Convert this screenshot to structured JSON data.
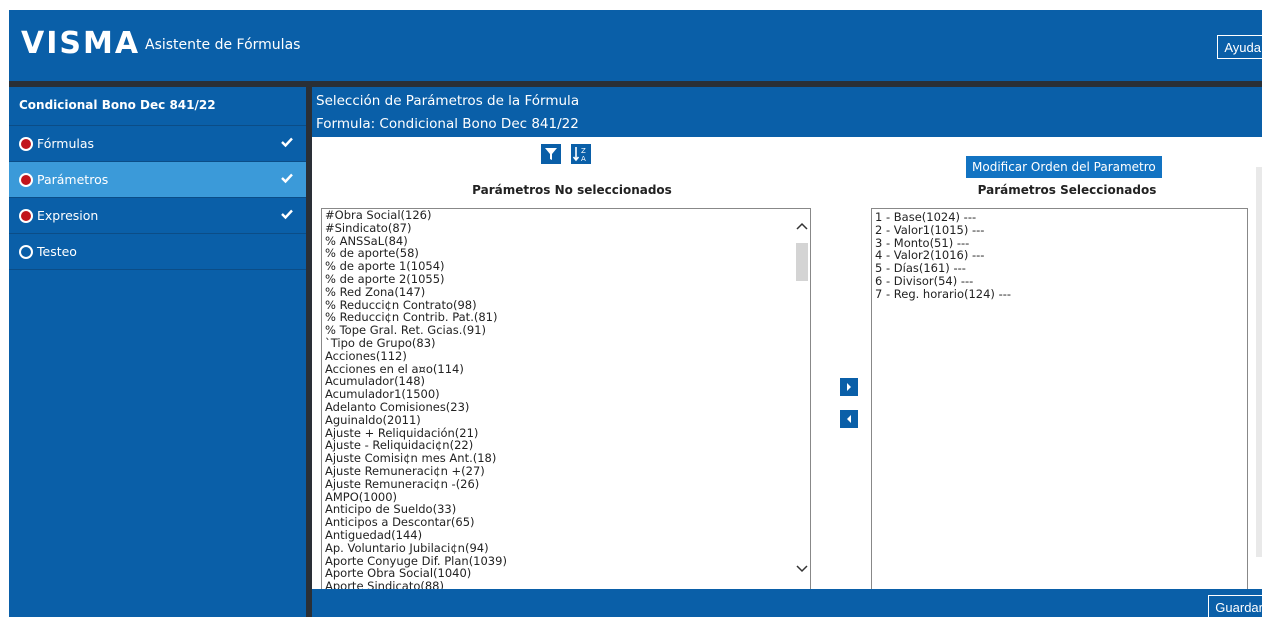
{
  "header": {
    "logo": "VISMA",
    "app_title": "Asistente de Fórmulas",
    "help_label": "Ayuda"
  },
  "sidebar": {
    "title": "Condicional Bono Dec 841/22",
    "items": [
      {
        "label": "Fórmulas",
        "state": "done"
      },
      {
        "label": "Parámetros",
        "state": "active"
      },
      {
        "label": "Expresion",
        "state": "done"
      },
      {
        "label": "Testeo",
        "state": "pending"
      }
    ]
  },
  "main": {
    "section_title": "Selección de Parámetros de la Fórmula",
    "formula_label": "Formula: Condicional Bono Dec 841/22",
    "left_title": "Parámetros No seleccionados",
    "right_title": "Parámetros Seleccionados",
    "order_button": "Modificar Orden del Parametro",
    "save_label": "Guardar"
  },
  "unselected_params": [
    "#Obra Social(126)",
    "#Sindicato(87)",
    "% ANSSaL(84)",
    "% de aporte(58)",
    "% de aporte 1(1054)",
    "% de aporte 2(1055)",
    "% Red Zona(147)",
    "% Reducci¢n Contrato(98)",
    "% Reducci¢n Contrib. Pat.(81)",
    "% Tope Gral. Ret. Gcias.(91)",
    "`Tipo de Grupo(83)",
    "Acciones(112)",
    "Acciones en el a¤o(114)",
    "Acumulador(148)",
    "Acumulador1(1500)",
    "Adelanto Comisiones(23)",
    "Aguinaldo(2011)",
    "Ajuste + Reliquidación(21)",
    "Ajuste - Reliquidaci¢n(22)",
    "Ajuste Comisi¢n mes Ant.(18)",
    "Ajuste Remuneraci¢n +(27)",
    "Ajuste Remuneraci¢n -(26)",
    "AMPO(1000)",
    "Anticipo de Sueldo(33)",
    "Anticipos a Descontar(65)",
    "Antiguedad(144)",
    "Ap. Voluntario Jubilaci¢n(94)",
    "Aporte Conyuge Dif. Plan(1039)",
    "Aporte Obra Social(1040)",
    "Aporte Sindicato(88)"
  ],
  "selected_params": [
    "1 - Base(1024) ---",
    "2 - Valor1(1015) ---",
    "3 - Monto(51) ---",
    "4 - Valor2(1016) ---",
    "5 - Días(161) ---",
    "6 - Divisor(54) ---",
    "7 - Reg. horario(124) ---"
  ],
  "colors": {
    "brand_blue": "#0a5fa8",
    "active_item": "#3b9ad9",
    "radio_red": "#c2141b"
  }
}
